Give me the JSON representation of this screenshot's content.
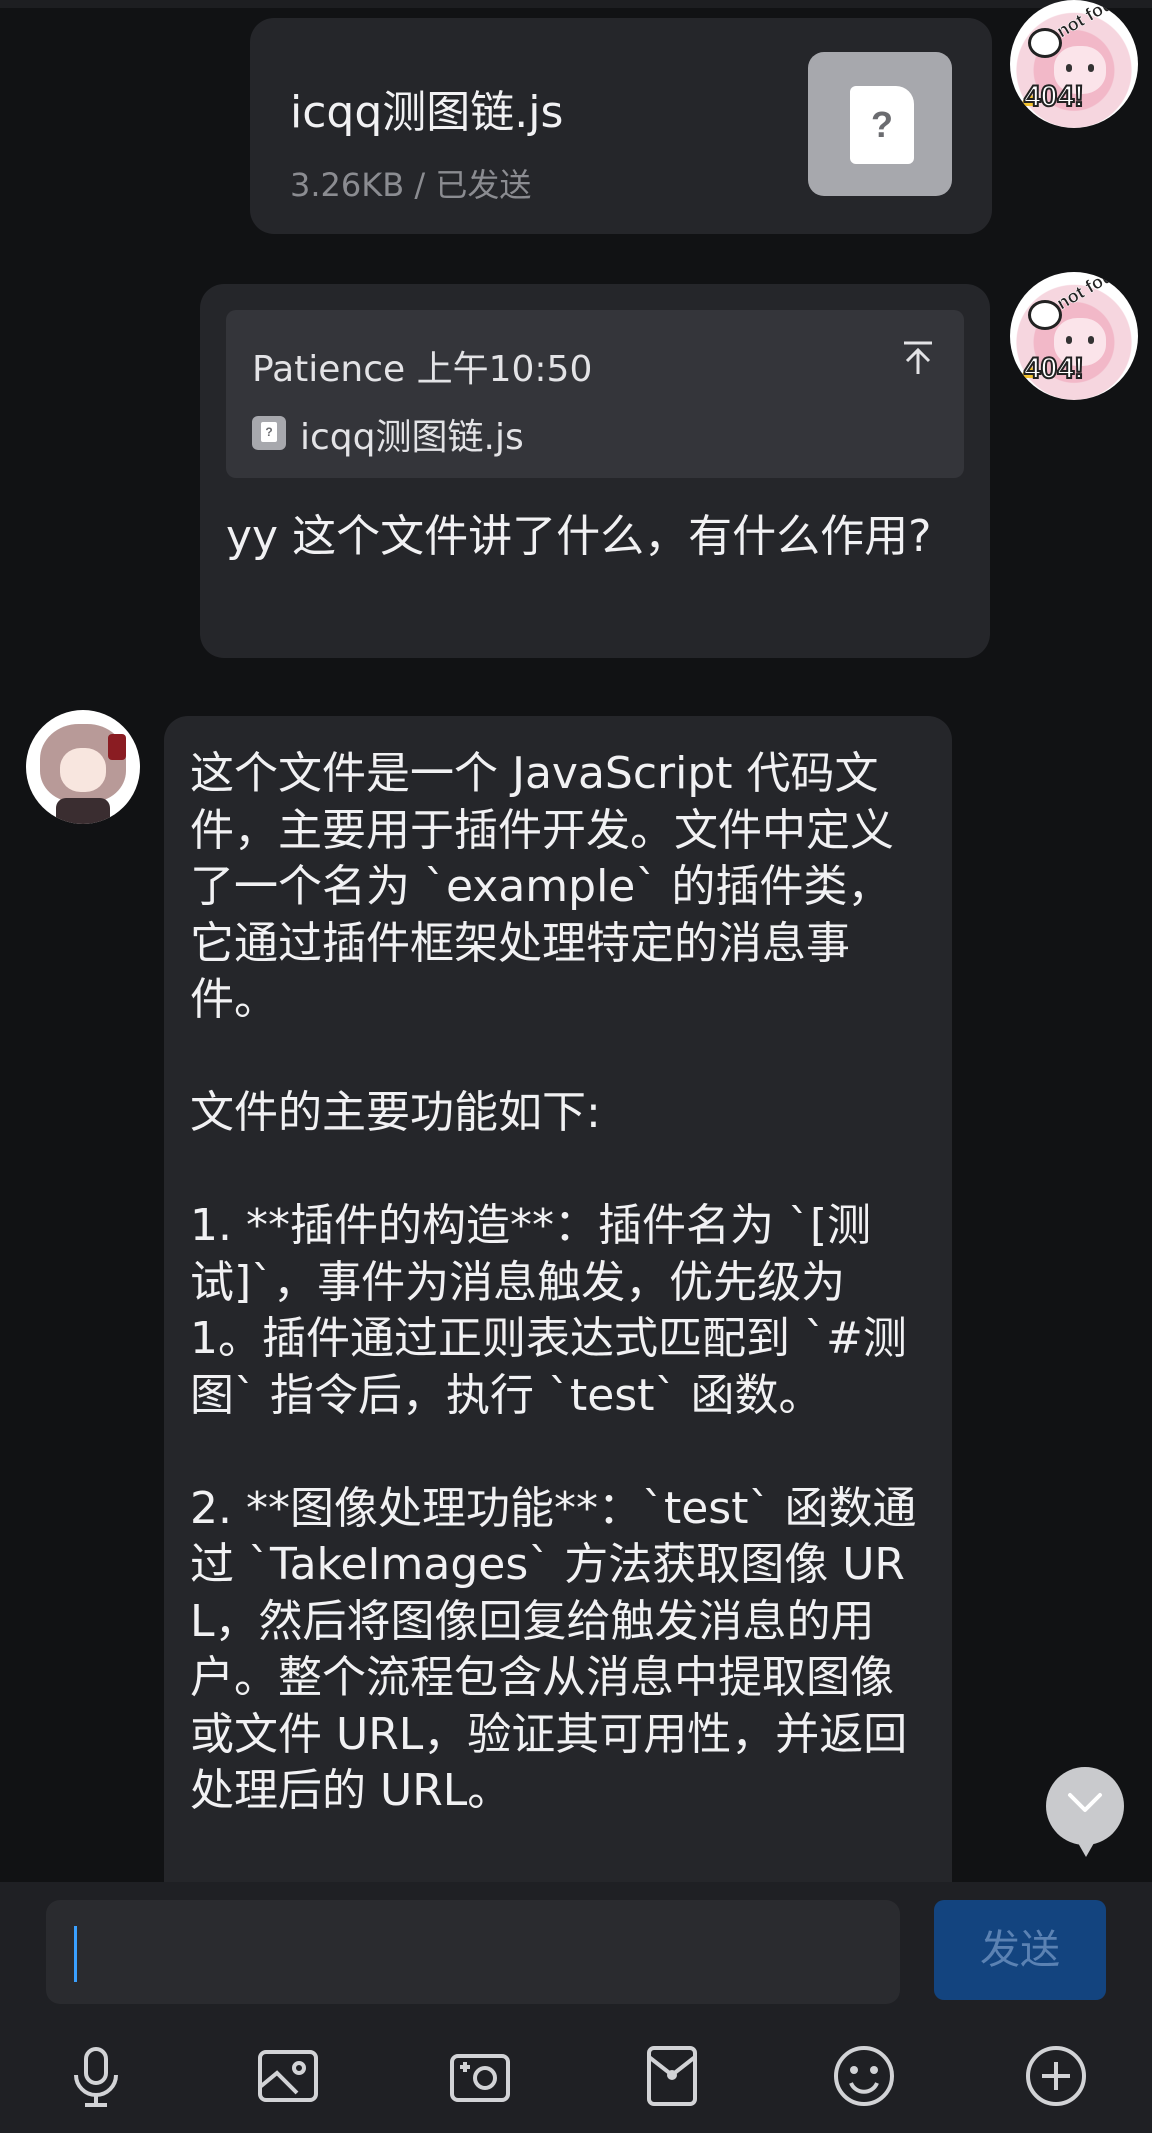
{
  "messages": {
    "file_card": {
      "file_name": "icqq测图链.js",
      "meta": "3.26KB / 已发送",
      "thumb_glyph": "?"
    },
    "reply": {
      "quote_author_time": "Patience 上午10:50",
      "quote_file_name": "icqq测图链.js",
      "quote_glyph": "?",
      "text": "yy 这个文件讲了什么，有什么作用?"
    },
    "bot": {
      "text": "这个文件是一个 JavaScript 代码文件，主要用于插件开发。文件中定义了一个名为 `example` 的插件类，它通过插件框架处理特定的消息事件。\n\n文件的主要功能如下:\n\n1. **插件的构造**：插件名为 `[测试]`，事件为消息触发，优先级为 1。插件通过正则表达式匹配到 `#测图` 指令后，执行 `test` 函数。\n\n2. **图像处理功能**：`test` 函数通过 `TakeImages` 方法获取图像 URL，然后将图像回复给触发消息的用户。整个流程包含从消息中提取图像或文件 URL，验证其可用性，并返回处理后的 URL。"
    },
    "self_avatar": {
      "badge_top": "not found",
      "badge_bottom": "404!"
    }
  },
  "composer": {
    "input_value": "",
    "send_label": "发送"
  },
  "toolbar": {
    "icons": [
      "microphone-icon",
      "image-icon",
      "camera-icon",
      "red-packet-icon",
      "emoji-icon",
      "plus-icon"
    ]
  },
  "colors": {
    "background": "#111214",
    "bubble": "#25262a",
    "quote": "#34353a",
    "send_button": "#13447f",
    "caret": "#3aa0ff"
  }
}
